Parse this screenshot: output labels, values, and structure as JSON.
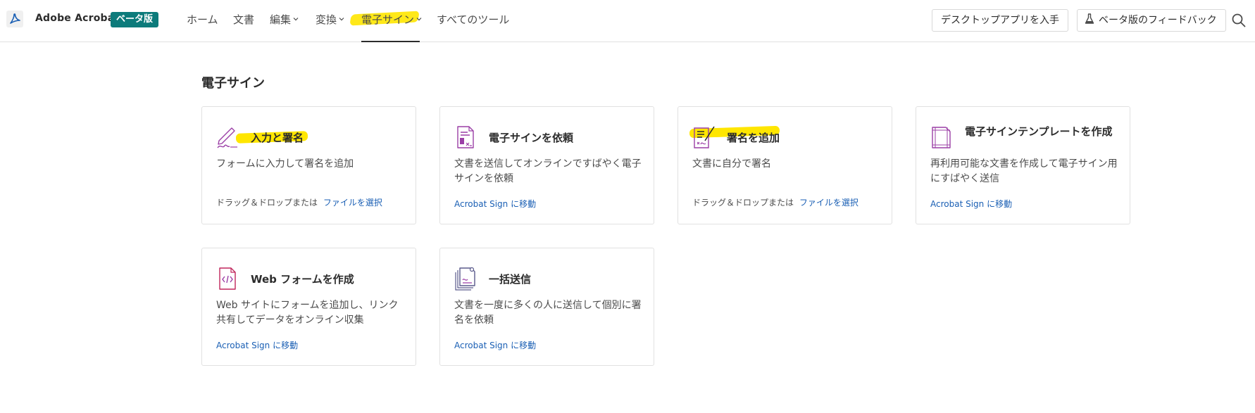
{
  "header": {
    "brand": "Adobe Acrobat",
    "beta_badge": "ベータ版",
    "nav": [
      {
        "label": "ホーム"
      },
      {
        "label": "文書"
      },
      {
        "label": "編集"
      },
      {
        "label": "変換"
      },
      {
        "label": "電子サイン"
      },
      {
        "label": "すべてのツール"
      }
    ],
    "desktop_button": "デスクトップアプリを入手",
    "feedback_button": "ベータ版のフィードバック",
    "icons": {
      "logo": "acrobat-logo-icon",
      "feedback": "flask-icon",
      "search": "search-icon"
    }
  },
  "main": {
    "section_title": "電子サイン",
    "cards": [
      {
        "title": "入力と署名",
        "desc": "フォームに入力して署名を追加",
        "foot_text": "ドラッグ＆ドロップまたは",
        "foot_link": "ファイルを選択",
        "icon": "fill-sign-icon"
      },
      {
        "title": "電子サインを依頼",
        "desc": "文書を送信してオンラインですばやく電子サインを依頼",
        "foot_text": "",
        "foot_link": "Acrobat Sign に移動",
        "icon": "request-esign-icon"
      },
      {
        "title": "署名を追加",
        "desc": "文書に自分で署名",
        "foot_text": "ドラッグ＆ドロップまたは",
        "foot_link": "ファイルを選択",
        "icon": "add-signature-icon"
      },
      {
        "title": "電子サインテンプレートを作成",
        "desc": "再利用可能な文書を作成して電子サイン用にすばやく送信",
        "foot_text": "",
        "foot_link": "Acrobat Sign に移動",
        "icon": "template-icon"
      },
      {
        "title": "Web フォームを作成",
        "desc": "Web サイトにフォームを追加し、リンク共有してデータをオンライン収集",
        "foot_text": "",
        "foot_link": "Acrobat Sign に移動",
        "icon": "web-form-icon"
      },
      {
        "title": "一括送信",
        "desc": "文書を一度に多くの人に送信して個別に署名を依頼",
        "foot_text": "",
        "foot_link": "Acrobat Sign に移動",
        "icon": "bulk-send-icon"
      }
    ]
  },
  "colors": {
    "accent_teal": "#0d7b7b",
    "link_blue": "#1a5fb4",
    "highlight_yellow": "#ffe600",
    "icon_purple": "#9b3fa6"
  }
}
